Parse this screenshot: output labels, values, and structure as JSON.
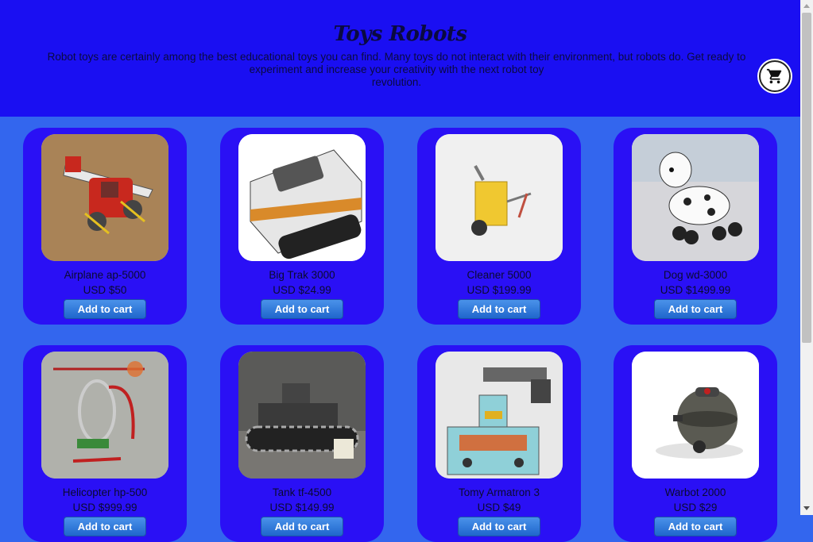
{
  "header": {
    "title": "Toys Robots",
    "description_line1": "Robot toys are certainly among the best educational toys you can find. Many toys do not interact with their environment, but robots do. Get ready to",
    "description_line2": "experiment and increase your creativity with the next robot toy",
    "description_line3": "revolution."
  },
  "cart": {
    "icon": "shopping-cart-icon"
  },
  "products": [
    {
      "name": "Airplane ap-5000",
      "price": "USD $50",
      "button": "Add to cart"
    },
    {
      "name": "Big Trak 3000",
      "price": "USD $24.99",
      "button": "Add to cart"
    },
    {
      "name": "Cleaner 5000",
      "price": "USD $199.99",
      "button": "Add to cart"
    },
    {
      "name": "Dog wd-3000",
      "price": "USD $1499.99",
      "button": "Add to cart"
    },
    {
      "name": "Helicopter hp-500",
      "price": "USD $999.99",
      "button": "Add to cart"
    },
    {
      "name": "Tank tf-4500",
      "price": "USD $149.99",
      "button": "Add to cart"
    },
    {
      "name": "Tomy Armatron 3",
      "price": "USD $49",
      "button": "Add to cart"
    },
    {
      "name": "Warbot 2000",
      "price": "USD $29",
      "button": "Add to cart"
    }
  ],
  "colors": {
    "header_bg": "#1a0ff2",
    "page_bg": "#3366ee",
    "card_bg": "#2a10f5",
    "button_bg": "#1f66cc"
  }
}
